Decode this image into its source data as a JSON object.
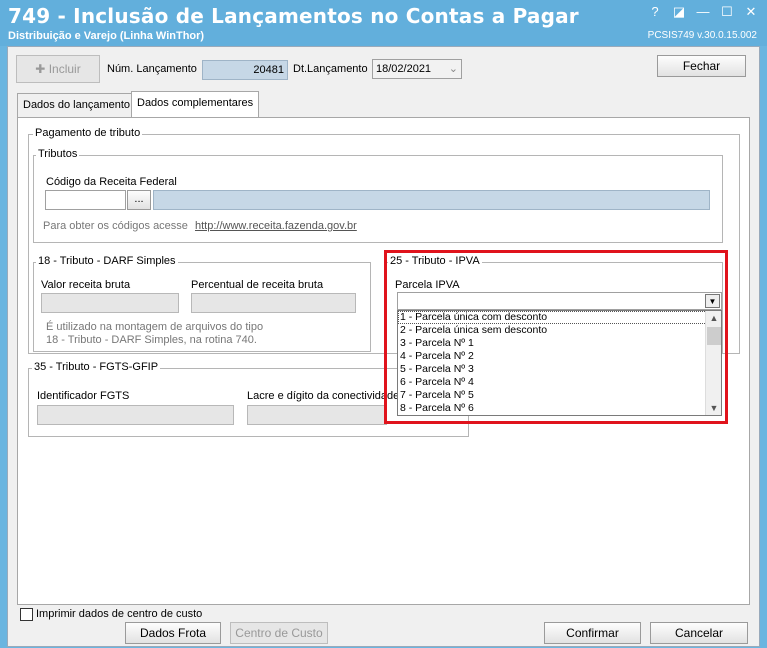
{
  "window": {
    "title": "749 - Inclusão de Lançamentos no Contas a Pagar",
    "subtitle": "Distribuição e Varejo (Linha WinThor)",
    "version": "PCSIS749  v.30.0.15.002",
    "controls": {
      "help": "?",
      "restore_alt": "◪",
      "minimize": "—",
      "maximize": "☐",
      "close": "✕"
    }
  },
  "toolbar": {
    "incluir_label": "Incluir",
    "incluir_icon": "✚",
    "num_lancamento_label": "Núm. Lançamento",
    "num_lancamento_value": "20481",
    "dt_lancamento_label": "Dt.Lançamento",
    "dt_lancamento_value": "18/02/2021",
    "fechar_label": "Fechar"
  },
  "tabs": [
    {
      "label": "Dados do lançamento",
      "active": false
    },
    {
      "label": "Dados complementares",
      "active": true
    }
  ],
  "pagamento_tributo": {
    "legend": "Pagamento de tributo",
    "tributos": {
      "legend": "Tributos",
      "codigo_label": "Código da Receita Federal",
      "codigo_value": "",
      "browse_label": "...",
      "hint_prefix": "Para obter os códigos acesse",
      "hint_link": "http://www.receita.fazenda.gov.br"
    },
    "darf": {
      "legend": "18 - Tributo - DARF Simples",
      "valor_label": "Valor receita bruta",
      "percentual_label": "Percentual de receita bruta",
      "note_line1": "É utilizado na montagem de arquivos do tipo",
      "note_line2": "18 - Tributo - DARF Simples, na rotina 740."
    },
    "ipva": {
      "legend": "25 - Tributo - IPVA",
      "parcela_label": "Parcela IPVA",
      "parcela_value": "",
      "options": [
        "1 - Parcela única com desconto",
        "2 - Parcela única sem desconto",
        "3 - Parcela Nº 1",
        "4 - Parcela Nº 2",
        "5 - Parcela Nº 3",
        "6 - Parcela Nº 4",
        "7 - Parcela Nº 5",
        "8 - Parcela Nº 6"
      ],
      "highlight_color": "#e0131c"
    },
    "fgts": {
      "legend": "35 - Tributo - FGTS-GFIP",
      "identificador_label": "Identificador FGTS",
      "lacre_label": "Lacre e dígito da conectividade"
    }
  },
  "footer": {
    "imprimir_label": "Imprimir dados de centro de custo",
    "dados_frota_label": "Dados Frota",
    "centro_custo_label": "Centro de Custo",
    "confirmar_label": "Confirmar",
    "cancelar_label": "Cancelar"
  }
}
